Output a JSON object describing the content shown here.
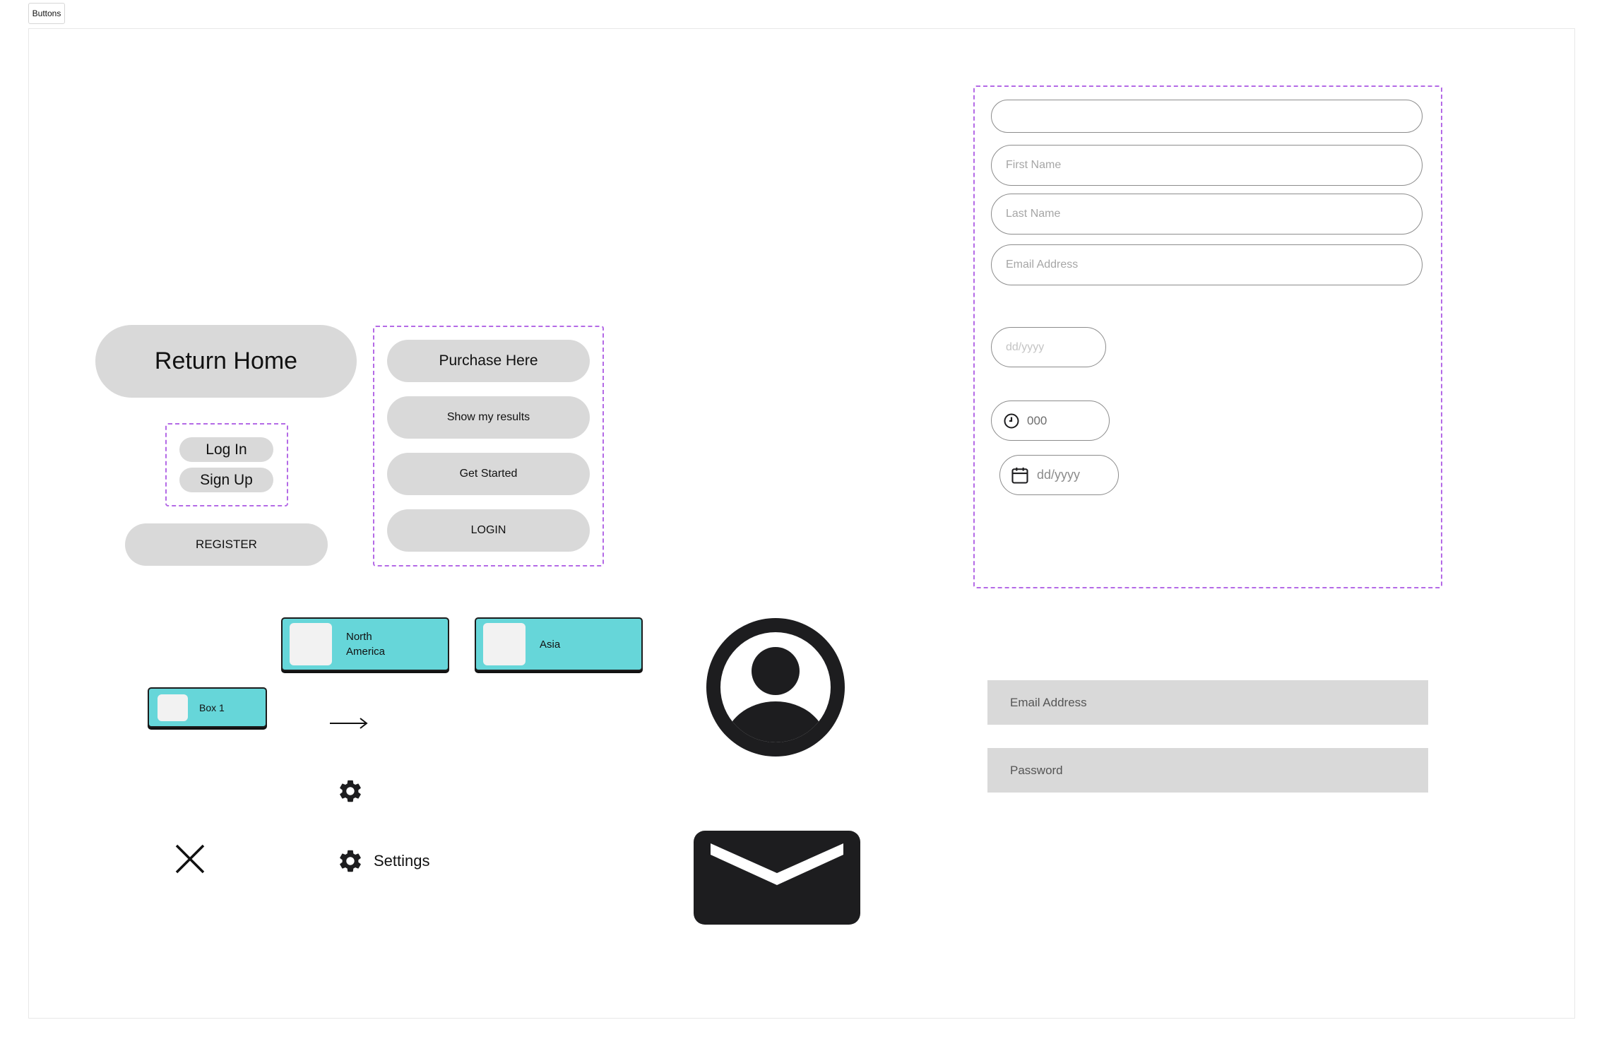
{
  "frame_label": "Buttons",
  "buttons": {
    "return_home": "Return Home",
    "log_in": "Log In",
    "sign_up": "Sign Up",
    "register": "REGISTER",
    "purchase_here": "Purchase Here",
    "show_my_results": "Show my results",
    "get_started": "Get Started",
    "login": "LOGIN"
  },
  "cards": {
    "north_america": "North\nAmerica",
    "asia": "Asia",
    "box1": "Box 1"
  },
  "settings_label": "Settings",
  "form": {
    "first_name_placeholder": "First Name",
    "last_name_placeholder": "Last Name",
    "email_placeholder": "Email Address",
    "date_placeholder": "dd/yyyy",
    "code_placeholder": "000",
    "date_icon_placeholder": "dd/yyyy"
  },
  "login_fields": {
    "email": "Email Address",
    "password": "Password"
  },
  "colors": {
    "card_teal": "#66d6d9",
    "button_gray": "#d9d9d9",
    "dashed_purple": "#b46ae6"
  },
  "icons": [
    "arrow-right-icon",
    "gear-icon",
    "close-icon",
    "user-circle-icon",
    "mail-icon",
    "clock-icon",
    "calendar-icon"
  ]
}
